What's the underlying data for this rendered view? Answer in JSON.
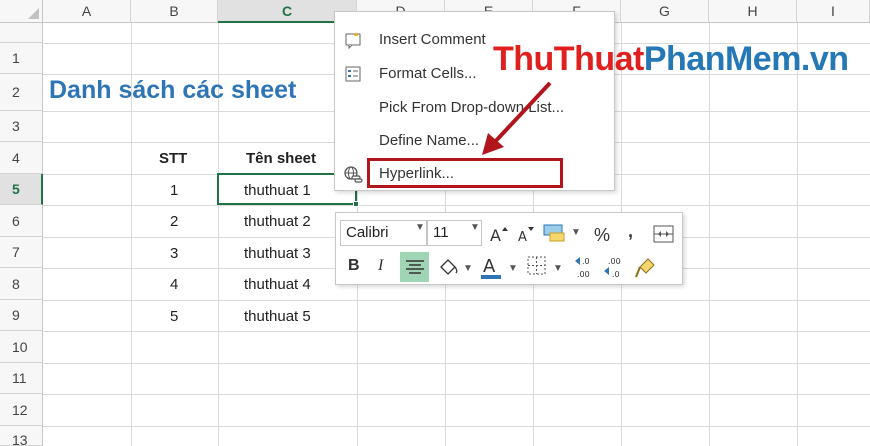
{
  "columns": [
    "A",
    "B",
    "C",
    "D",
    "E",
    "F",
    "G",
    "H",
    "I"
  ],
  "active_column": "C",
  "rows": [
    "1",
    "2",
    "3",
    "4",
    "5",
    "6",
    "7",
    "8",
    "9",
    "10",
    "11",
    "12",
    "13"
  ],
  "active_row": "5",
  "cells": {
    "title": "Danh sách các sheet",
    "header_stt": "STT",
    "header_name": "Tên sheet",
    "data": [
      {
        "stt": "1",
        "name": "thuthuat 1"
      },
      {
        "stt": "2",
        "name": "thuthuat 2"
      },
      {
        "stt": "3",
        "name": "thuthuat 3"
      },
      {
        "stt": "4",
        "name": "thuthuat 4"
      },
      {
        "stt": "5",
        "name": "thuthuat 5"
      }
    ]
  },
  "context_menu": {
    "items": [
      {
        "label": "Insert Comment",
        "icon": "comment-icon"
      },
      {
        "label": "Format Cells...",
        "icon": "format-cells-icon"
      },
      {
        "label": "Pick From Drop-down List...",
        "icon": ""
      },
      {
        "label": "Define Name...",
        "icon": ""
      },
      {
        "label": "Hyperlink...",
        "icon": "hyperlink-icon"
      }
    ]
  },
  "watermark": {
    "part1": "ThuThuat",
    "part2": "PhanMem.vn"
  },
  "mini_toolbar": {
    "font_name": "Calibri",
    "font_size": "11",
    "bold": "B",
    "italic": "I",
    "percent": "%",
    "comma": ","
  },
  "colors": {
    "title_blue": "#2e75b6",
    "excel_green": "#217346",
    "highlight_red": "#b0161b",
    "watermark_red": "#e0201f",
    "watermark_blue": "#2478b5"
  }
}
